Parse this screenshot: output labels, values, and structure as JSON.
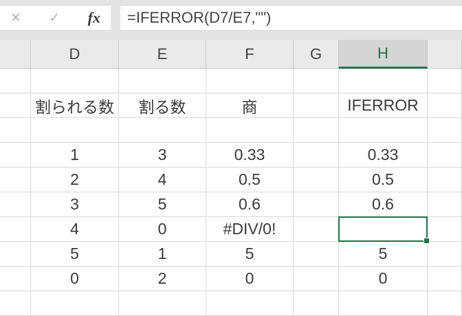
{
  "formula_bar": {
    "cancel_icon": "✕",
    "confirm_icon": "✓",
    "function_icon": "fx",
    "formula": "=IFERROR(D7/E7,\"\")"
  },
  "columns": {
    "labels": [
      "",
      "D",
      "E",
      "F",
      "G",
      "H",
      ""
    ],
    "selected": "H"
  },
  "sheet": {
    "rows": [
      [
        "",
        "",
        "",
        "",
        "",
        "",
        ""
      ],
      [
        "",
        "割られる数",
        "割る数",
        "商",
        "",
        "IFERROR",
        ""
      ],
      [
        "",
        "",
        "",
        "",
        "",
        "",
        ""
      ],
      [
        "",
        "1",
        "3",
        "0.33",
        "",
        "0.33",
        ""
      ],
      [
        "",
        "2",
        "4",
        "0.5",
        "",
        "0.5",
        ""
      ],
      [
        "",
        "3",
        "5",
        "0.6",
        "",
        "0.6",
        ""
      ],
      [
        "",
        "4",
        "0",
        "#DIV/0!",
        "",
        "",
        ""
      ],
      [
        "",
        "5",
        "1",
        "5",
        "",
        "5",
        ""
      ],
      [
        "",
        "0",
        "2",
        "0",
        "",
        "0",
        ""
      ],
      [
        "",
        "",
        "",
        "",
        "",
        "",
        ""
      ]
    ],
    "selection": {
      "column": "H",
      "row_index": 6,
      "value": ""
    }
  },
  "colors": {
    "accent_green": "#217346",
    "gridline": "#d9d9d9",
    "header_bg": "#eaeaea",
    "selected_header_bg": "#d5d5d5",
    "chrome_bg": "#e4e4e4",
    "cell_text": "#3a3a3a"
  }
}
